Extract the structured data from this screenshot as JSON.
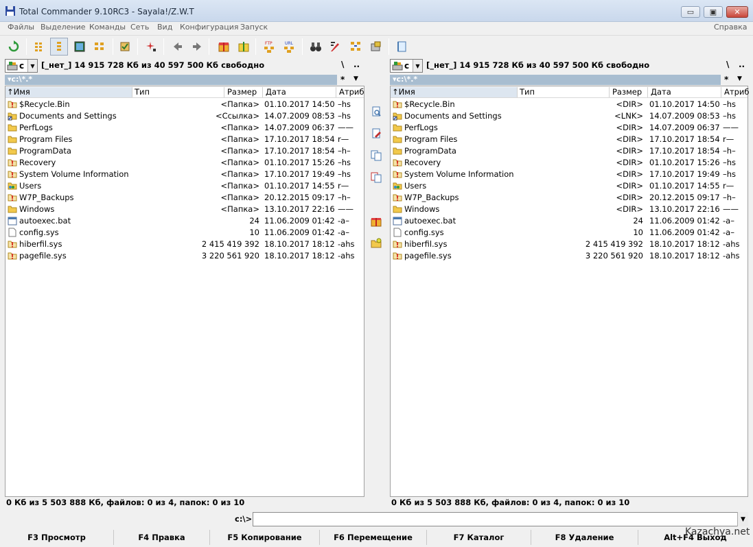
{
  "window": {
    "title": "Total Commander 9.10RC3 - Sayala!/Z.W.T",
    "minimize_glyph": "▭",
    "maximize_glyph": "▣",
    "close_glyph": "✕"
  },
  "menu": [
    "Файлы",
    "Выделение",
    "Команды",
    "Сеть",
    "Вид",
    "Конфигурация",
    "Запуск"
  ],
  "help_menu": "Справка",
  "toolbar": {
    "ftp_label": "FTP",
    "url_label": "URL",
    "buttons": [
      "refresh-icon",
      "brief-view-icon",
      "full-view-icon",
      "thumbnails-icon",
      "tree-view-icon",
      "invert-selection-icon",
      "compare-icon",
      "back-icon",
      "forward-icon",
      "pack-icon",
      "unpack-icon",
      "ftp-connect-icon",
      "url-connect-icon",
      "find-icon",
      "multi-rename-icon",
      "sync-dirs-icon",
      "disk-icon",
      "notepad-icon"
    ]
  },
  "left": {
    "drive": "c",
    "drive_info": "[_нет_]  14 915 728 Кб из 40 597 500 Кб свободно",
    "root": "\\",
    "up": "..",
    "path": "c:\\*.*",
    "filter": "*",
    "dropdown": "▼",
    "columns": {
      "name": "Имя",
      "type": "Тип",
      "size": "Размер",
      "date": "Дата",
      "attr": "Атриб"
    },
    "files": [
      {
        "icon": "warning-icon",
        "name": "$Recycle.Bin",
        "size": "<Папка>",
        "date": "01.10.2017 14:50",
        "attr": "–hs"
      },
      {
        "icon": "link-icon",
        "name": "Documents and Settings",
        "size": "<Ссылка>",
        "date": "14.07.2009 08:53",
        "attr": "–hs"
      },
      {
        "icon": "folder-icon",
        "name": "PerfLogs",
        "size": "<Папка>",
        "date": "14.07.2009 06:37",
        "attr": "——"
      },
      {
        "icon": "folder-icon",
        "name": "Program Files",
        "size": "<Папка>",
        "date": "17.10.2017 18:54",
        "attr": "r—"
      },
      {
        "icon": "folder-icon",
        "name": "ProgramData",
        "size": "<Папка>",
        "date": "17.10.2017 18:54",
        "attr": "–h–"
      },
      {
        "icon": "warning-icon",
        "name": "Recovery",
        "size": "<Папка>",
        "date": "01.10.2017 15:26",
        "attr": "–hs"
      },
      {
        "icon": "warning-icon",
        "name": "System Volume Information",
        "size": "<Папка>",
        "date": "17.10.2017 19:49",
        "attr": "–hs"
      },
      {
        "icon": "users-folder-icon",
        "name": "Users",
        "size": "<Папка>",
        "date": "01.10.2017 14:55",
        "attr": "r—"
      },
      {
        "icon": "warning-icon",
        "name": "W7P_Backups",
        "size": "<Папка>",
        "date": "20.12.2015 09:17",
        "attr": "–h–"
      },
      {
        "icon": "folder-icon",
        "name": "Windows",
        "size": "<Папка>",
        "date": "13.10.2017 22:16",
        "attr": "——"
      },
      {
        "icon": "bat-file-icon",
        "name": "autoexec.bat",
        "size": "24",
        "date": "11.06.2009 01:42",
        "attr": "-a–"
      },
      {
        "icon": "file-icon",
        "name": "config.sys",
        "size": "10",
        "date": "11.06.2009 01:42",
        "attr": "-a–"
      },
      {
        "icon": "warning-icon",
        "name": "hiberfil.sys",
        "size": "2 415 419 392",
        "date": "18.10.2017 18:12",
        "attr": "-ahs"
      },
      {
        "icon": "warning-icon",
        "name": "pagefile.sys",
        "size": "3 220 561 920",
        "date": "18.10.2017 18:12",
        "attr": "-ahs"
      }
    ],
    "status": "0 Кб из 5 503 888 Кб, файлов: 0 из 4, папок: 0 из 10"
  },
  "right": {
    "drive": "c",
    "drive_info": "[_нет_]  14 915 728 Кб из 40 597 500 Кб свободно",
    "root": "\\",
    "up": "..",
    "path": "c:\\*.*",
    "filter": "*",
    "dropdown": "▼",
    "columns": {
      "name": "Имя",
      "type": "Тип",
      "size": "Размер",
      "date": "Дата",
      "attr": "Атриб"
    },
    "files": [
      {
        "icon": "warning-icon",
        "name": "$Recycle.Bin",
        "size": "<DIR>",
        "date": "01.10.2017 14:50",
        "attr": "–hs"
      },
      {
        "icon": "link-icon",
        "name": "Documents and Settings",
        "size": "<LNK>",
        "date": "14.07.2009 08:53",
        "attr": "–hs"
      },
      {
        "icon": "folder-icon",
        "name": "PerfLogs",
        "size": "<DIR>",
        "date": "14.07.2009 06:37",
        "attr": "——"
      },
      {
        "icon": "folder-icon",
        "name": "Program Files",
        "size": "<DIR>",
        "date": "17.10.2017 18:54",
        "attr": "r—"
      },
      {
        "icon": "folder-icon",
        "name": "ProgramData",
        "size": "<DIR>",
        "date": "17.10.2017 18:54",
        "attr": "–h–"
      },
      {
        "icon": "warning-icon",
        "name": "Recovery",
        "size": "<DIR>",
        "date": "01.10.2017 15:26",
        "attr": "–hs"
      },
      {
        "icon": "warning-icon",
        "name": "System Volume Information",
        "size": "<DIR>",
        "date": "17.10.2017 19:49",
        "attr": "–hs"
      },
      {
        "icon": "users-folder-icon",
        "name": "Users",
        "size": "<DIR>",
        "date": "01.10.2017 14:55",
        "attr": "r—"
      },
      {
        "icon": "warning-icon",
        "name": "W7P_Backups",
        "size": "<DIR>",
        "date": "20.12.2015 09:17",
        "attr": "–h–"
      },
      {
        "icon": "folder-icon",
        "name": "Windows",
        "size": "<DIR>",
        "date": "13.10.2017 22:16",
        "attr": "——"
      },
      {
        "icon": "bat-file-icon",
        "name": "autoexec.bat",
        "size": "24",
        "date": "11.06.2009 01:42",
        "attr": "-a–"
      },
      {
        "icon": "file-icon",
        "name": "config.sys",
        "size": "10",
        "date": "11.06.2009 01:42",
        "attr": "-a–"
      },
      {
        "icon": "warning-icon",
        "name": "hiberfil.sys",
        "size": "2 415 419 392",
        "date": "18.10.2017 18:12",
        "attr": "-ahs"
      },
      {
        "icon": "warning-icon",
        "name": "pagefile.sys",
        "size": "3 220 561 920",
        "date": "18.10.2017 18:12",
        "attr": "-ahs"
      }
    ],
    "status": "0 Кб из 5 503 888 Кб, файлов: 0 из 4, папок: 0 из 10"
  },
  "middle_buttons": [
    "view-icon",
    "edit-icon",
    "copy-icon",
    "move-icon",
    "pack-icon",
    "new-folder-icon"
  ],
  "cmdline": {
    "prompt": "c:\\>",
    "value": "",
    "dropdown": "▼"
  },
  "fkeys": [
    "F3 Просмотр",
    "F4 Правка",
    "F5 Копирование",
    "F6 Перемещение",
    "F7 Каталог",
    "F8 Удаление",
    "Alt+F4 Выход"
  ],
  "watermark": "Kazachya.net",
  "colors": {
    "path_bar": "#a8bdd0",
    "title_bg": "#dbe6f4",
    "folder": "#f2c94c",
    "warning": "#d83a2a"
  }
}
